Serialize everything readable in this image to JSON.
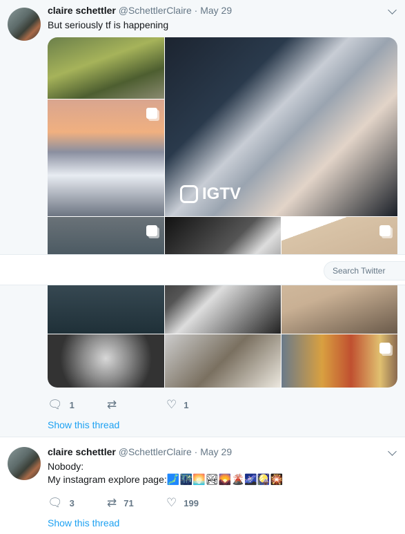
{
  "tweets": [
    {
      "name": "claire schettler",
      "handle": "@SchettlerClaire",
      "sep": "·",
      "date": "May 29",
      "lines": [
        "But seriously tf is happening"
      ],
      "media_badge": "IGTV",
      "replies": "1",
      "retweets": "",
      "likes": "1",
      "show_thread": "Show this thread"
    },
    {
      "name": "claire schettler",
      "handle": "@SchettlerClaire",
      "sep": "·",
      "date": "May 29",
      "lines": [
        "Nobody:",
        "My instagram explore page:"
      ],
      "emojis": "🗾🌃🌅🏞🌄🌋🌌🎑🎇",
      "replies": "3",
      "retweets": "71",
      "likes": "199",
      "show_thread": "Show this thread"
    }
  ],
  "search": {
    "placeholder": "Search Twitter"
  },
  "icons": {
    "reply": "reply-icon",
    "retweet": "retweet-icon",
    "like": "heart-icon",
    "caret": "chevron-down-icon"
  },
  "colors": {
    "link": "#1da1f2",
    "muted": "#657786",
    "hover_bg": "#f5f8fa"
  }
}
